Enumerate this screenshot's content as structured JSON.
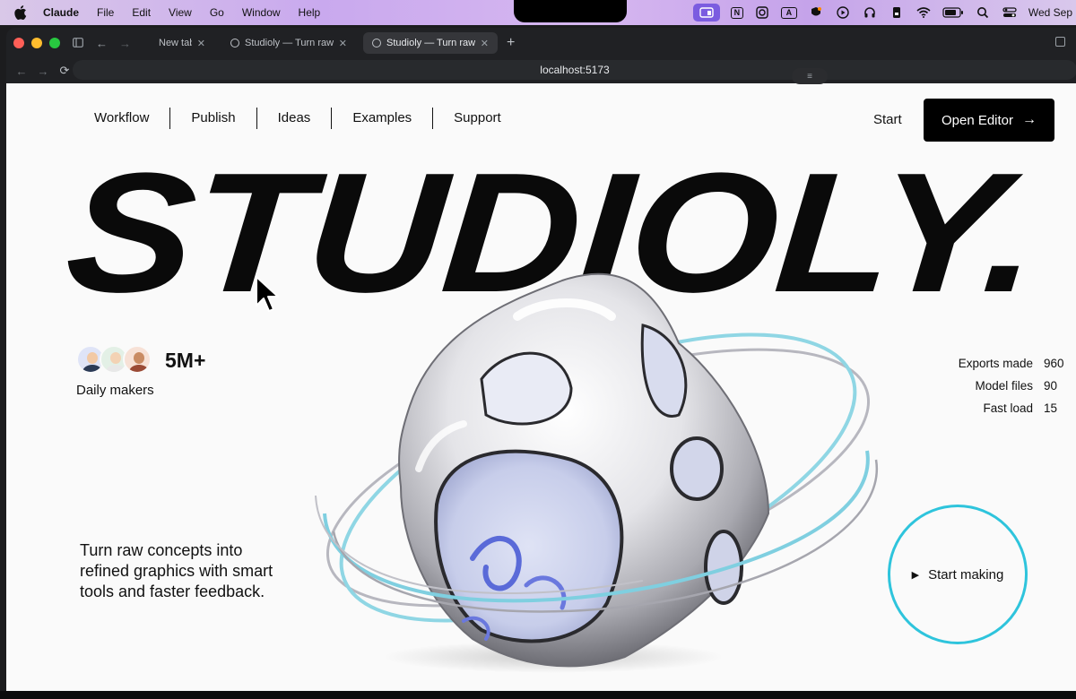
{
  "menubar": {
    "app_name": "Claude",
    "items": [
      "File",
      "Edit",
      "View",
      "Go",
      "Window",
      "Help"
    ],
    "tray_icons": [
      "screen-share-icon",
      "notion-icon",
      "record-icon",
      "keyboard-a-icon",
      "vpn-icon",
      "play-icon",
      "headphones-icon",
      "device-icon",
      "wifi-icon",
      "battery-icon",
      "search-icon",
      "control-center-icon"
    ],
    "clock": "Wed Sep"
  },
  "browser": {
    "tabs": [
      {
        "label": "New tab"
      },
      {
        "label": "Studioly — Turn raw co"
      },
      {
        "label": "Studioly — Turn raw co"
      }
    ],
    "active_tab": 2,
    "url": "localhost:5173",
    "handle_glyph": "≡"
  },
  "page": {
    "nav": [
      "Workflow",
      "Publish",
      "Ideas",
      "Examples",
      "Support"
    ],
    "start_link": "Start",
    "cta_label": "Open Editor",
    "cta_arrow": "→",
    "hero_title": "STUDIOLY.",
    "makers_count": "5M+",
    "makers_label": "Daily makers",
    "stats": [
      {
        "label": "Exports made",
        "value": "960"
      },
      {
        "label": "Model files",
        "value": "90"
      },
      {
        "label": "Fast load",
        "value": "15"
      }
    ],
    "tagline": "Turn raw concepts into refined graphics with smart tools and faster feedback.",
    "start_making_label": "Start making",
    "start_making_icon": "▶"
  },
  "colors": {
    "accent_ring": "#2ec4dc",
    "cta_bg": "#000000",
    "page_bg": "#fafafa",
    "menubar_purple": "#c9a9ee"
  }
}
